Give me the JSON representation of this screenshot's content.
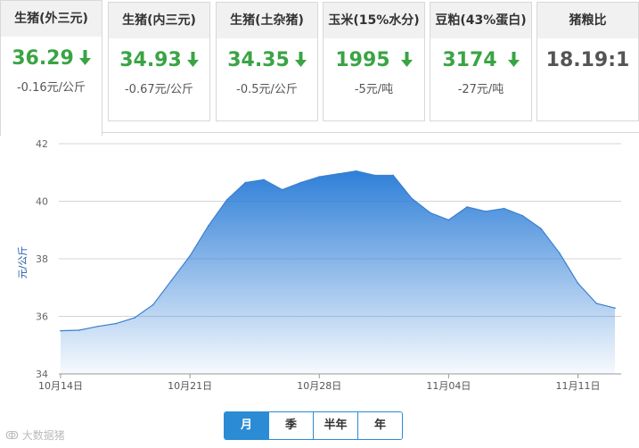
{
  "tabs": [
    {
      "name": "生猪(外三元)",
      "price": "36.29",
      "change": "-0.16元/公斤",
      "trend": "down"
    },
    {
      "name": "生猪(内三元)",
      "price": "34.93",
      "change": "-0.67元/公斤",
      "trend": "down"
    },
    {
      "name": "生猪(土杂猪)",
      "price": "34.35",
      "change": "-0.5元/公斤",
      "trend": "down"
    },
    {
      "name": "玉米(15%水分)",
      "price": "1995",
      "change": "-5元/吨",
      "trend": "down"
    },
    {
      "name": "豆粕(43%蛋白)",
      "price": "3174",
      "change": "-27元/吨",
      "trend": "down"
    },
    {
      "name": "猪粮比",
      "price": "18.19:1",
      "change": "",
      "trend": ""
    }
  ],
  "colors": {
    "down": "#3aa444",
    "accent": "#2b8bd4",
    "line": "#3a7fcf"
  },
  "periods": [
    {
      "label": "月",
      "active": true
    },
    {
      "label": "季",
      "active": false
    },
    {
      "label": "半年",
      "active": false
    },
    {
      "label": "年",
      "active": false
    }
  ],
  "watermark": "大数据猪",
  "chart_data": {
    "type": "area",
    "title": "",
    "xlabel": "",
    "ylabel": "元/公斤",
    "ylim": [
      34,
      42
    ],
    "yticks": [
      34,
      36,
      38,
      40,
      42
    ],
    "grid": true,
    "x_tick_labels": [
      "10月14日",
      "10月21日",
      "10月28日",
      "11月04日",
      "11月11日"
    ],
    "x_tick_index": [
      0,
      7,
      14,
      21,
      28
    ],
    "x": [
      "10-14",
      "10-15",
      "10-16",
      "10-17",
      "10-18",
      "10-19",
      "10-20",
      "10-21",
      "10-22",
      "10-23",
      "10-24",
      "10-25",
      "10-26",
      "10-27",
      "10-28",
      "10-29",
      "10-30",
      "10-31",
      "11-01",
      "11-02",
      "11-03",
      "11-04",
      "11-05",
      "11-06",
      "11-07",
      "11-08",
      "11-09",
      "11-10",
      "11-11",
      "11-12",
      "11-13"
    ],
    "series": [
      {
        "values": [
          35.5,
          35.52,
          35.65,
          35.75,
          35.95,
          36.4,
          37.25,
          38.1,
          39.15,
          40.05,
          40.65,
          40.75,
          40.4,
          40.65,
          40.85,
          40.95,
          41.05,
          40.9,
          40.9,
          40.1,
          39.6,
          39.35,
          39.8,
          39.65,
          39.75,
          39.5,
          39.05,
          38.2,
          37.15,
          36.45,
          36.29
        ]
      }
    ]
  }
}
